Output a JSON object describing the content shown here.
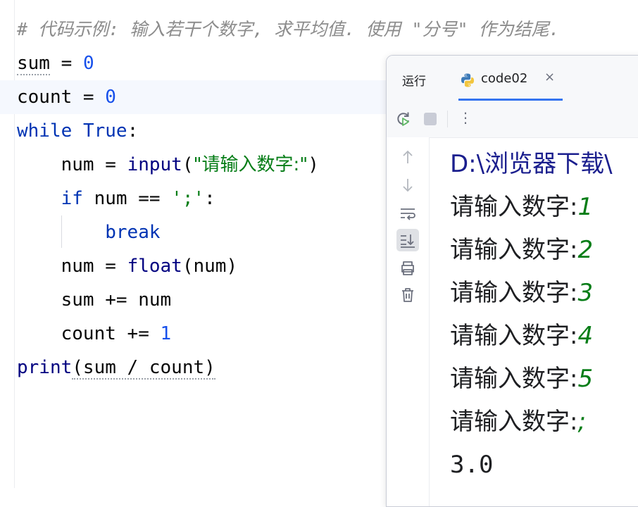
{
  "editor": {
    "comment": "# 代码示例: 输入若干个数字, 求平均值. 使用 \"分号\" 作为结尾.",
    "lines": [
      {
        "a": "sum",
        "b": " = ",
        "c": "0"
      },
      {
        "a": "count",
        "b": " = ",
        "c": "0"
      },
      {
        "kw": "while",
        "sp": " ",
        "kw2": "True",
        "colon": ":"
      },
      {
        "indent": "    ",
        "a": "num",
        "b": " = ",
        "fn": "input",
        "p1": "(",
        "str": "\"请输入数字:\"",
        "p2": ")"
      },
      {
        "indent": "    ",
        "kw": "if",
        "b": " num == ",
        "str": "';'",
        "colon": ":"
      },
      {
        "indent": "        ",
        "kw": "break"
      },
      {
        "indent": "    ",
        "a": "num",
        "b": " = ",
        "fn": "float",
        "rest": "(num)"
      },
      {
        "indent": "    ",
        "a": "sum += num"
      },
      {
        "indent": "    ",
        "a": "count += ",
        "num": "1"
      },
      {
        "fn": "print",
        "rest": "(sum / count)"
      }
    ]
  },
  "run_panel": {
    "title": "运行",
    "tab_label": "code02",
    "tab_close": "×",
    "toolbar_icons": [
      "rerun-icon",
      "stop-icon",
      "more-icon"
    ],
    "more_glyph": "⋮",
    "side_icons": [
      "up-arrow-icon",
      "down-arrow-icon",
      "soft-wrap-icon",
      "scroll-to-end-icon",
      "print-icon",
      "trash-icon"
    ],
    "console": {
      "path": "D:\\浏览器下载\\",
      "prompt": "请输入数字:",
      "inputs": [
        "1",
        "2",
        "3",
        "4",
        "5",
        ";"
      ],
      "result": "3.0"
    }
  }
}
